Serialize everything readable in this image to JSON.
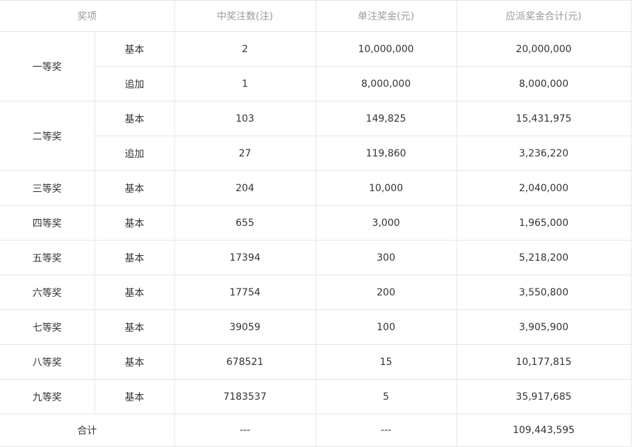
{
  "header": {
    "item": "奖项",
    "winners": "中奖注数(注)",
    "per_prize": "单注奖金(元)",
    "total": "应派奖金合计(元)"
  },
  "rows": [
    {
      "prize": "一等奖",
      "type": "基本",
      "winners": "2",
      "per_prize": "10,000,000",
      "total": "20,000,000"
    },
    {
      "prize": "一等奖",
      "type": "追加",
      "winners": "1",
      "per_prize": "8,000,000",
      "total": "8,000,000"
    },
    {
      "prize": "二等奖",
      "type": "基本",
      "winners": "103",
      "per_prize": "149,825",
      "total": "15,431,975"
    },
    {
      "prize": "二等奖",
      "type": "追加",
      "winners": "27",
      "per_prize": "119,860",
      "total": "3,236,220"
    },
    {
      "prize": "三等奖",
      "type": "基本",
      "winners": "204",
      "per_prize": "10,000",
      "total": "2,040,000"
    },
    {
      "prize": "四等奖",
      "type": "基本",
      "winners": "655",
      "per_prize": "3,000",
      "total": "1,965,000"
    },
    {
      "prize": "五等奖",
      "type": "基本",
      "winners": "17394",
      "per_prize": "300",
      "total": "5,218,200"
    },
    {
      "prize": "六等奖",
      "type": "基本",
      "winners": "17754",
      "per_prize": "200",
      "total": "3,550,800"
    },
    {
      "prize": "七等奖",
      "type": "基本",
      "winners": "39059",
      "per_prize": "100",
      "total": "3,905,900"
    },
    {
      "prize": "八等奖",
      "type": "基本",
      "winners": "678521",
      "per_prize": "15",
      "total": "10,177,815"
    },
    {
      "prize": "九等奖",
      "type": "基本",
      "winners": "7183537",
      "per_prize": "5",
      "total": "35,917,685"
    }
  ],
  "total_row": {
    "label": "合计",
    "winners": "---",
    "per_prize": "---",
    "total": "109,443,595"
  }
}
